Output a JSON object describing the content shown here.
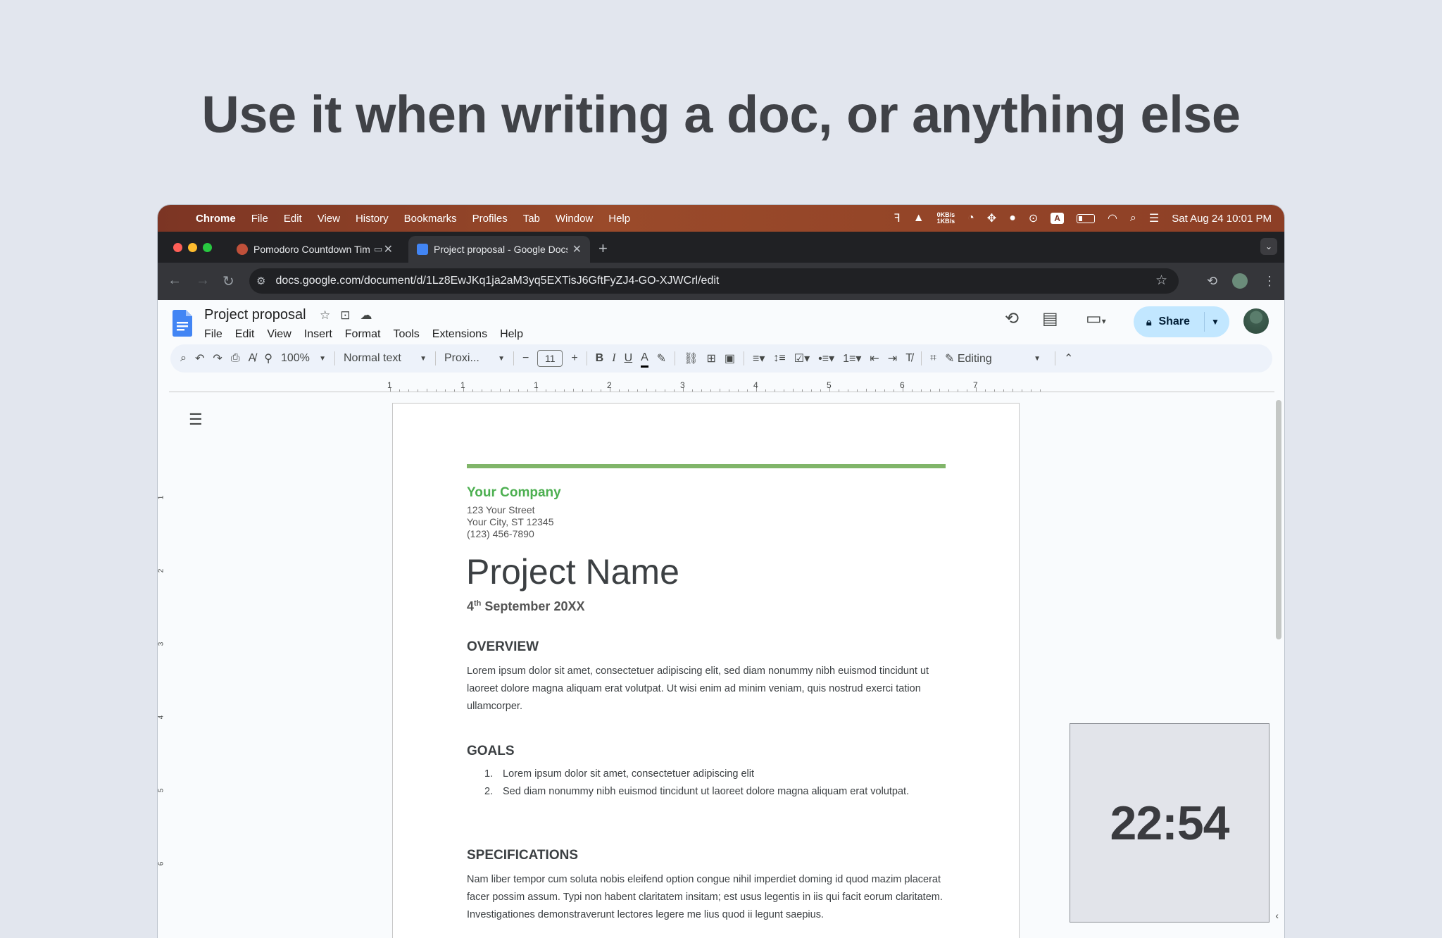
{
  "headline": "Use it when writing a doc, or anything else",
  "mac_menubar": {
    "app": "Chrome",
    "items": [
      "File",
      "Edit",
      "View",
      "History",
      "Bookmarks",
      "Profiles",
      "Tab",
      "Window",
      "Help"
    ],
    "net_up": "0KB/s",
    "net_down": "1KB/s",
    "input_badge": "A",
    "clock": "Sat Aug 24  10:01 PM"
  },
  "tabs": [
    {
      "title": "Pomodoro Countdown Timer",
      "active": false
    },
    {
      "title": "Project proposal - Google Docs",
      "active": true
    }
  ],
  "address_bar": {
    "url": "docs.google.com/document/d/1Lz8EwJKq1ja2aM3yq5EXTisJ6GftFyZJ4-GO-XJWCrl/edit"
  },
  "docs": {
    "title": "Project proposal",
    "menu": [
      "File",
      "Edit",
      "View",
      "Insert",
      "Format",
      "Tools",
      "Extensions",
      "Help"
    ],
    "share_label": "Share",
    "toolbar": {
      "zoom": "100%",
      "style": "Normal text",
      "font": "Proxi...",
      "font_size": "11",
      "mode": "Editing"
    },
    "ruler_numbers": [
      "1",
      "1",
      "1",
      "2",
      "3",
      "4",
      "5",
      "6",
      "7"
    ],
    "vruler_numbers": [
      "1",
      "2",
      "3",
      "4",
      "5",
      "6"
    ]
  },
  "document": {
    "company": "Your Company",
    "address_lines": [
      "123 Your Street",
      "Your City, ST 12345",
      "(123) 456-7890"
    ],
    "project_name": "Project Name",
    "date_day": "4",
    "date_suffix": "th",
    "date_rest": " September 20XX",
    "overview_heading": "OVERVIEW",
    "overview_text": "Lorem ipsum dolor sit amet, consectetuer adipiscing elit, sed diam nonummy nibh euismod tincidunt ut laoreet dolore magna aliquam erat volutpat. Ut wisi enim ad minim veniam, quis nostrud exerci tation ullamcorper.",
    "goals_heading": "GOALS",
    "goals": [
      {
        "num": "1.",
        "text": "Lorem ipsum dolor sit amet, consectetuer adipiscing elit"
      },
      {
        "num": "2.",
        "text": "Sed diam nonummy nibh euismod tincidunt ut laoreet dolore magna aliquam erat volutpat."
      }
    ],
    "specs_heading": "SPECIFICATIONS",
    "specs_text": "Nam liber tempor cum soluta nobis eleifend option congue nihil imperdiet doming id quod mazim placerat facer possim assum. Typi non habent claritatem insitam; est usus legentis in iis qui facit eorum claritatem. Investigationes demonstraverunt lectores legere me lius quod ii legunt saepius."
  },
  "timer": {
    "value": "22:54"
  },
  "colors": {
    "accent_green": "#4caf50",
    "share_bg": "#c2e7ff",
    "menubar": "#8d3f26"
  }
}
